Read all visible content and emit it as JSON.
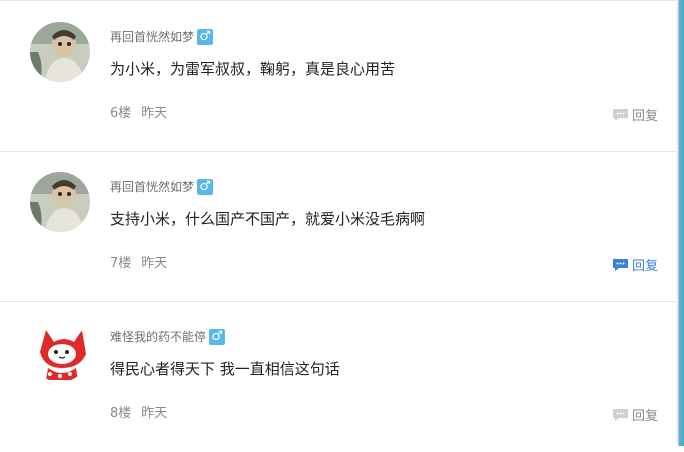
{
  "comments": [
    {
      "username": "再回首恍然如梦",
      "gender_symbol": "♂",
      "content": "为小米，为雷军叔叔，鞠躬，真是良心用苦",
      "floor": "6楼",
      "time": "昨天",
      "reply_label": "回复",
      "reply_active": false
    },
    {
      "username": "再回首恍然如梦",
      "gender_symbol": "♂",
      "content": "支持小米，什么国产不国产，就爱小米没毛病啊",
      "floor": "7楼",
      "time": "昨天",
      "reply_label": "回复",
      "reply_active": true
    },
    {
      "username": "难怪我的药不能停",
      "gender_symbol": "♂",
      "content": "得民心者得天下 我一直相信这句话",
      "floor": "8楼",
      "time": "昨天",
      "reply_label": "回复",
      "reply_active": false
    }
  ],
  "colors": {
    "gender_badge": "#59b8ea",
    "reply_active": "#3a82d6",
    "reply_idle": "#8a8a8a"
  },
  "icons": {
    "gender": "male-icon",
    "reply": "speech-bubble-icon"
  }
}
